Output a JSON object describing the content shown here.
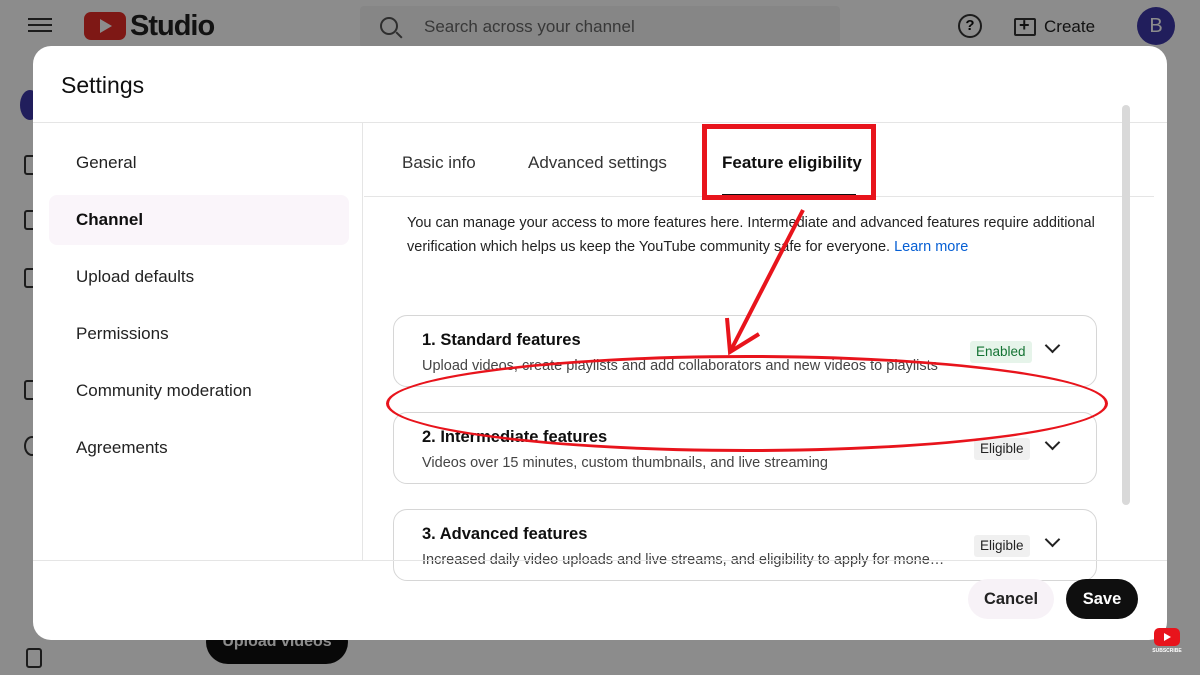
{
  "app": {
    "logo_text": "Studio",
    "search_placeholder": "Search across your channel",
    "help_glyph": "?",
    "create_label": "Create",
    "avatar_letter": "B",
    "upload_button_label": "Upload videos"
  },
  "dialog": {
    "title": "Settings",
    "nav": [
      {
        "label": "General"
      },
      {
        "label": "Channel",
        "active": true
      },
      {
        "label": "Upload defaults"
      },
      {
        "label": "Permissions"
      },
      {
        "label": "Community moderation"
      },
      {
        "label": "Agreements"
      }
    ],
    "tabs": [
      {
        "label": "Basic info"
      },
      {
        "label": "Advanced settings"
      },
      {
        "label": "Feature eligibility",
        "active": true
      }
    ],
    "description": "You can manage your access to more features here. Intermediate and advanced features require additional verification which helps us keep the YouTube community safe for everyone.",
    "learn_more": "Learn more",
    "features": [
      {
        "title": "1. Standard features",
        "subtitle": "Upload videos, create playlists and add collaborators and new videos to playlists",
        "status": "Enabled"
      },
      {
        "title": "2. Intermediate features",
        "subtitle": "Videos over 15 minutes, custom thumbnails, and live streaming",
        "status": "Eligible"
      },
      {
        "title": "3. Advanced features",
        "subtitle": "Increased daily video uploads and live streams, and eligibility to apply for mone…",
        "status": "Eligible"
      }
    ],
    "cancel_label": "Cancel",
    "save_label": "Save"
  },
  "overlay": {
    "subscribe_text": "SUBSCRIBE",
    "annotation_color": "#e8141c"
  },
  "colors": {
    "link": "#065fd4",
    "enabled_badge_bg": "#e6f4ea",
    "enabled_badge_fg": "#137333",
    "brand_red": "#e52d27"
  }
}
